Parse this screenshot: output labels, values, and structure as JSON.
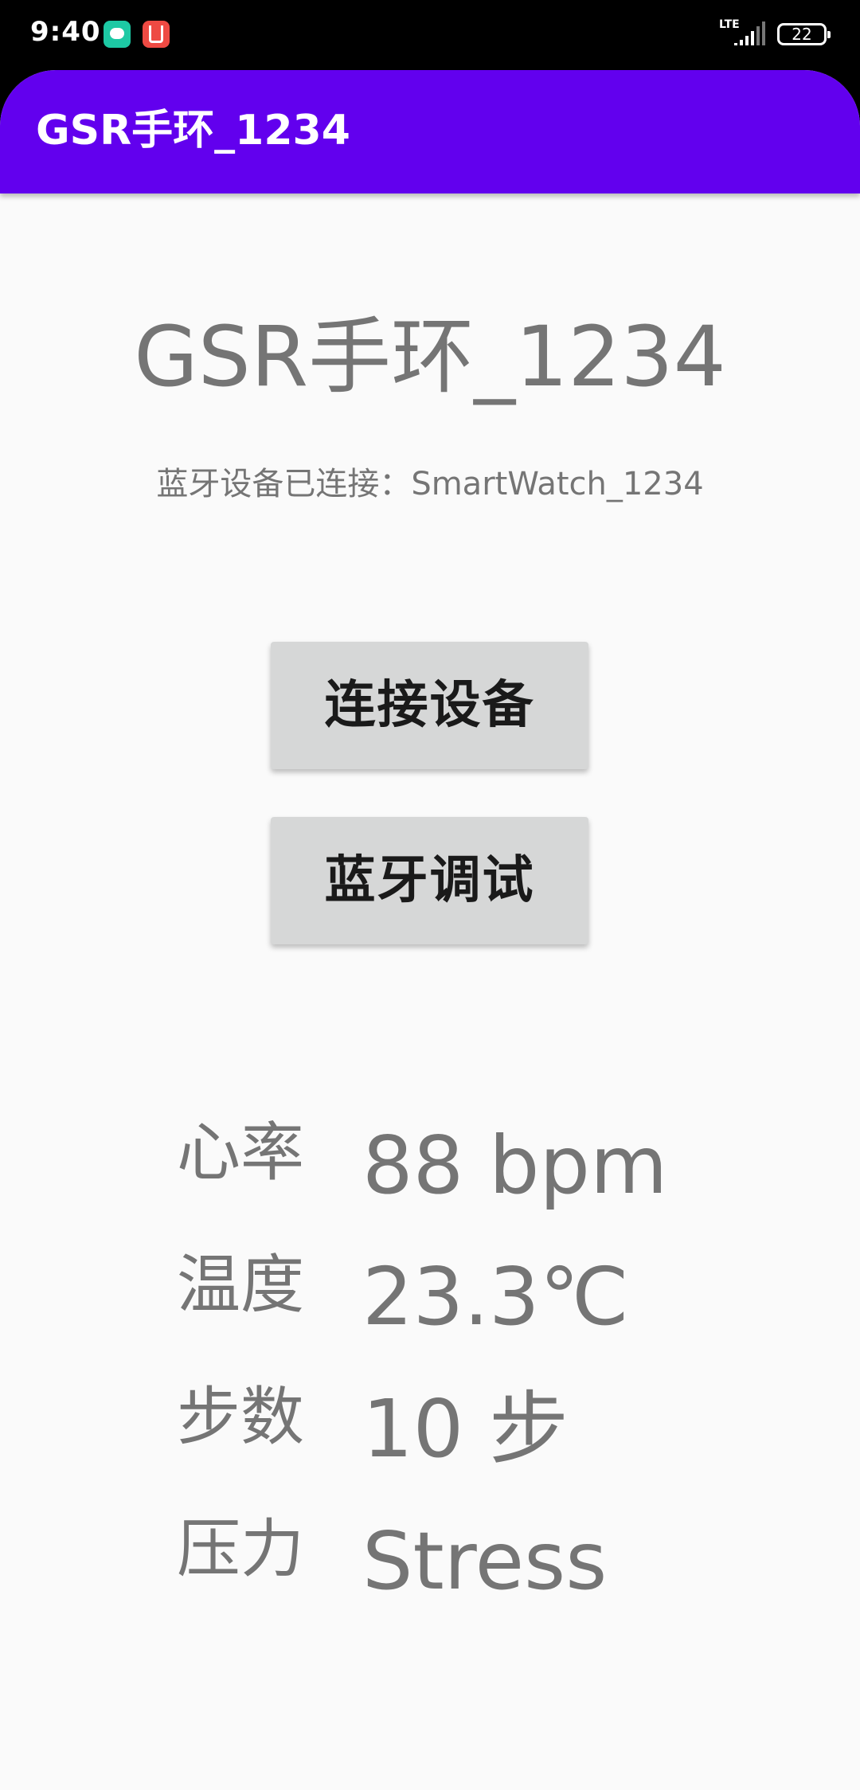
{
  "status_bar": {
    "time": "9:40",
    "network": "LTE",
    "battery": "22",
    "notification_icons": [
      "chat-icon",
      "gift-icon"
    ]
  },
  "app_bar": {
    "title": "GSR手环_1234",
    "color": "#6200ee"
  },
  "main": {
    "heading": "GSR手环_1234",
    "connection_status": "蓝牙设备已连接：SmartWatch_1234",
    "connect_button": "连接设备",
    "debug_button": "蓝牙调试"
  },
  "metrics": [
    {
      "label": "心率",
      "value": "88 bpm"
    },
    {
      "label": "温度",
      "value": "23.3℃"
    },
    {
      "label": "步数",
      "value": "10 步"
    },
    {
      "label": "压力",
      "value": "Stress"
    }
  ]
}
